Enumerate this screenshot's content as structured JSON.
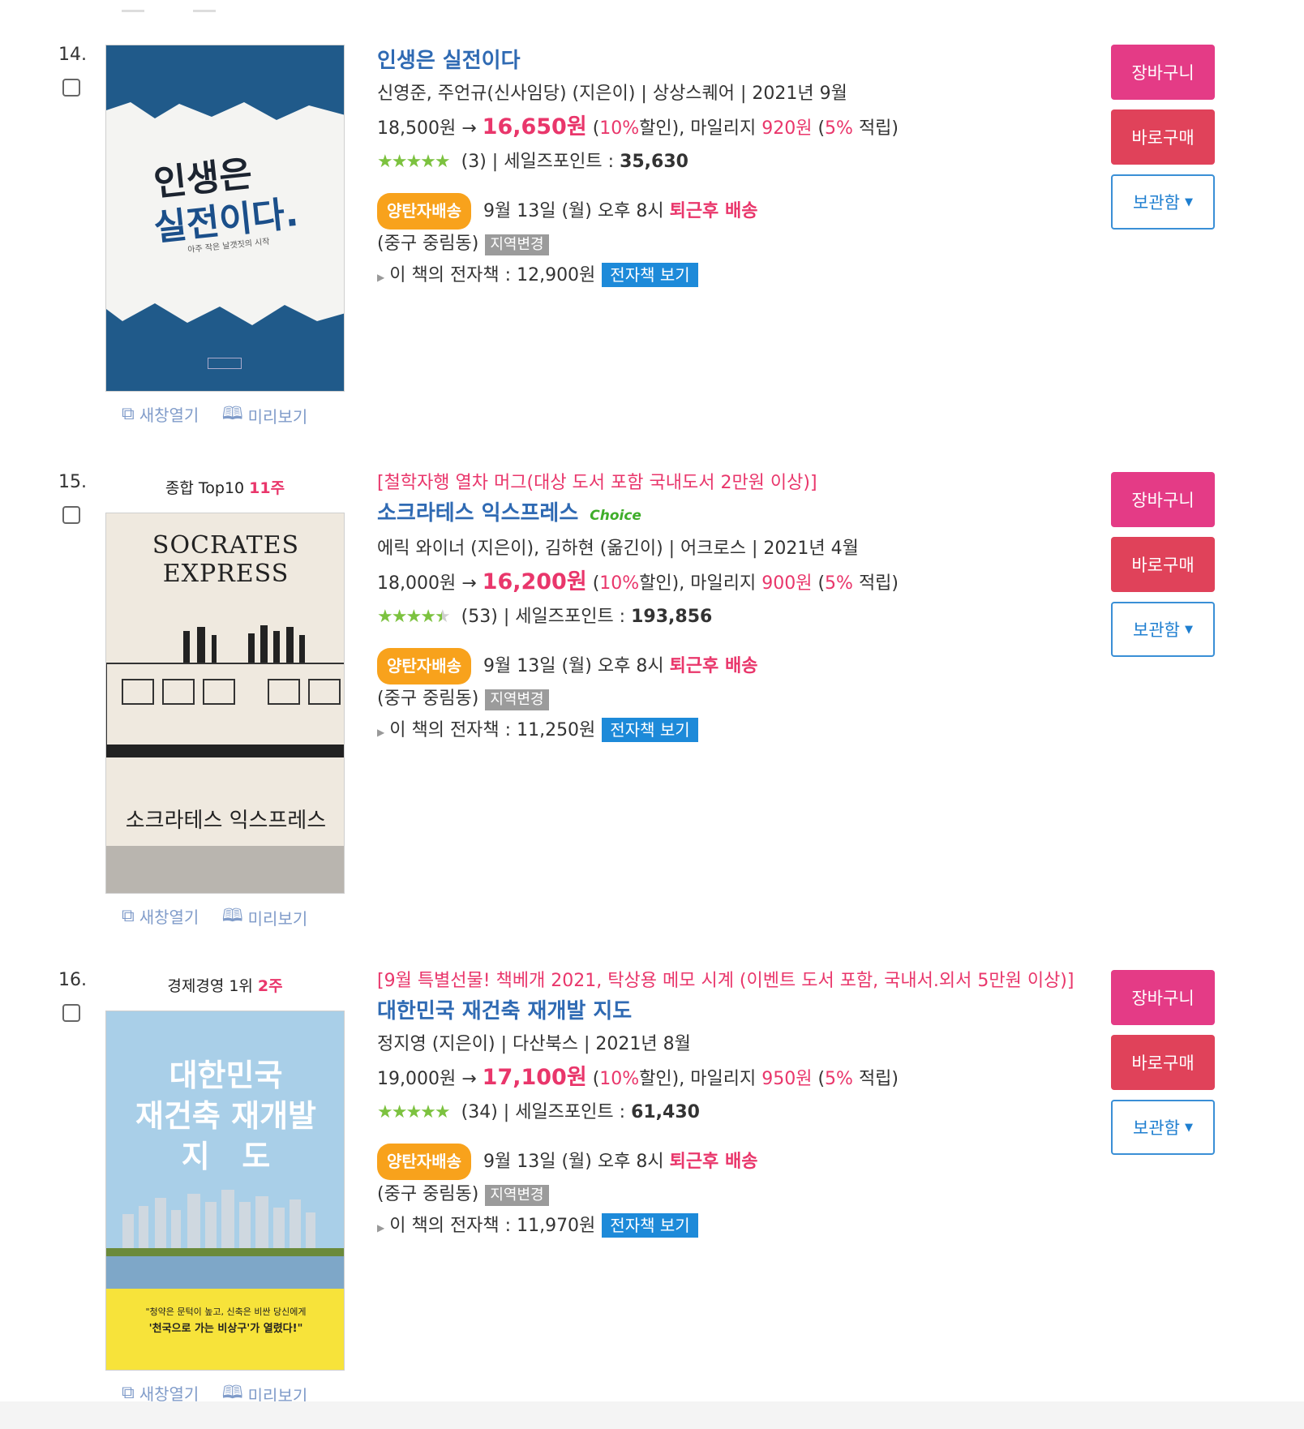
{
  "labels": {
    "cart": "장바구니",
    "buy_now": "바로구매",
    "save": "보관함",
    "new_window": "새창열기",
    "preview": "미리보기",
    "fast_ship": "양탄자배송",
    "region_change": "지역변경",
    "ebook_view": "전자책 보기"
  },
  "items": [
    {
      "rank": "14.",
      "rank_label": "",
      "rank_weeks": "",
      "promo": "",
      "title": "인생은 실전이다",
      "choice": "",
      "authors": "신영준, 주언규(신사임당) (지은이) | 상상스퀘어 | 2021년 9월",
      "list_price": "18,500원 →",
      "sale_price": "16,650원",
      "discount_pre": "(",
      "discount_pct": "10%",
      "discount_mid": "할인), 마일리지",
      "mileage": "920원",
      "mileage_pre": "(",
      "mileage_pct": "5%",
      "mileage_post": "적립)",
      "stars": "★★★★★",
      "rating_value": 5,
      "review_count": "(3)",
      "sales_label": "| 세일즈포인트 :",
      "sales_point": "35,630",
      "delivery_date": "9월 13일 (월) 오후 8시",
      "delivery_tag": "퇴근후 배송",
      "location": "(중구 중림동)",
      "ebook_label": "이 책의 전자책 :",
      "ebook_price": "12,900원",
      "cover_title_1": "인생은",
      "cover_title_2": "실전이다.",
      "cover_subtitle": "아주 작은 날갯짓의 시작"
    },
    {
      "rank": "15.",
      "rank_label": "종합 Top10",
      "rank_weeks": "11주",
      "promo": "[철학자행 열차 머그(대상 도서 포함 국내도서 2만원 이상)]",
      "title": "소크라테스 익스프레스",
      "choice": "Choice",
      "authors": "에릭 와이너 (지은이), 김하현 (옮긴이) | 어크로스 | 2021년 4월",
      "list_price": "18,000원 →",
      "sale_price": "16,200원",
      "discount_pre": "(",
      "discount_pct": "10%",
      "discount_mid": "할인), 마일리지",
      "mileage": "900원",
      "mileage_pre": "(",
      "mileage_pct": "5%",
      "mileage_post": "적립)",
      "stars": "★★★★★",
      "rating_value": 4.5,
      "review_count": "(53)",
      "sales_label": "| 세일즈포인트 :",
      "sales_point": "193,856",
      "delivery_date": "9월 13일 (월) 오후 8시",
      "delivery_tag": "퇴근후 배송",
      "location": "(중구 중림동)",
      "ebook_label": "이 책의 전자책 :",
      "ebook_price": "11,250원",
      "cover_title_1": "SOCRATES EXPRESS",
      "cover_title_2": "소크라테스 익스프레스",
      "cover_subtitle": ""
    },
    {
      "rank": "16.",
      "rank_label": "경제경영 1위",
      "rank_weeks": "2주",
      "promo": "[9월 특별선물! 책베개 2021, 탁상용 메모 시계 (이벤트 도서 포함, 국내서.외서 5만원 이상)]",
      "title": "대한민국 재건축 재개발 지도",
      "choice": "",
      "authors": "정지영 (지은이) | 다산북스 | 2021년 8월",
      "list_price": "19,000원 →",
      "sale_price": "17,100원",
      "discount_pre": "(",
      "discount_pct": "10%",
      "discount_mid": "할인), 마일리지",
      "mileage": "950원",
      "mileage_pre": "(",
      "mileage_pct": "5%",
      "mileage_post": "적립)",
      "stars": "★★★★★",
      "rating_value": 5,
      "review_count": "(34)",
      "sales_label": "| 세일즈포인트 :",
      "sales_point": "61,430",
      "delivery_date": "9월 13일 (월) 오후 8시",
      "delivery_tag": "퇴근후 배송",
      "location": "(중구 중림동)",
      "ebook_label": "이 책의 전자책 :",
      "ebook_price": "11,970원",
      "cover_title_1": "대한민국",
      "cover_title_2": "재건축 재개발",
      "cover_title_3": "지   도",
      "cover_quote_1": "\"청약은 문턱이 높고, 신축은 비싼 당신에게",
      "cover_quote_2": "'천국으로 가는 비상구'가 열렸다!\""
    }
  ],
  "colors": {
    "accent_pink": "#e9366b",
    "title_blue": "#2f6ab3",
    "cart_button": "#e43b86",
    "buy_button": "#e0425a",
    "ship_badge": "#f8a21c",
    "ebook_button": "#1d8ad9"
  },
  "icons": {
    "new_window": "window-icon",
    "preview": "book-icon",
    "save_caret": "caret-down-icon",
    "ebook_bullet": "triangle-right-icon"
  }
}
